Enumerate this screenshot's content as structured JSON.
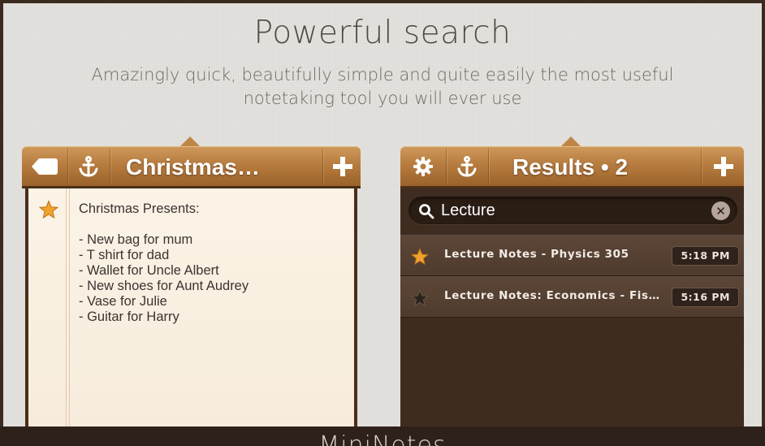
{
  "hero": {
    "title": "Powerful search",
    "subtitle_line1": "Amazingly quick, beautifully simple and quite easily the most useful",
    "subtitle_line2": "notetaking tool you will ever use"
  },
  "note_panel": {
    "back_icon": "back-tag-icon",
    "anchor_icon": "anchor-icon",
    "title": "Christmas…",
    "add_icon": "plus-icon",
    "starred": true,
    "lines": [
      "Christmas Presents:",
      "",
      "- New bag for mum",
      "- T shirt for dad",
      "- Wallet for Uncle Albert",
      "- New shoes for Aunt Audrey",
      "- Vase for Julie",
      "- Guitar for Harry"
    ]
  },
  "results_panel": {
    "settings_icon": "gear-icon",
    "anchor_icon": "anchor-icon",
    "title": "Results • 2",
    "add_icon": "plus-icon",
    "search": {
      "value": "Lecture",
      "icon": "search-icon",
      "clear_icon": "clear-icon"
    },
    "results": [
      {
        "title": "Lecture Notes - Physics 305",
        "time": "5:18 PM",
        "starred": true
      },
      {
        "title": "Lecture Notes: Economics - Fiscal…",
        "time": "5:16 PM",
        "starred": false
      }
    ]
  },
  "footer": {
    "brand": "MiniNotes"
  },
  "colors": {
    "wood_light": "#cf9a5c",
    "wood_dark": "#9a622a",
    "paper": "#fbf3e6",
    "results_bg": "#3f2c20",
    "star_gold": "#f0a22a",
    "star_empty": "#2b241e"
  }
}
